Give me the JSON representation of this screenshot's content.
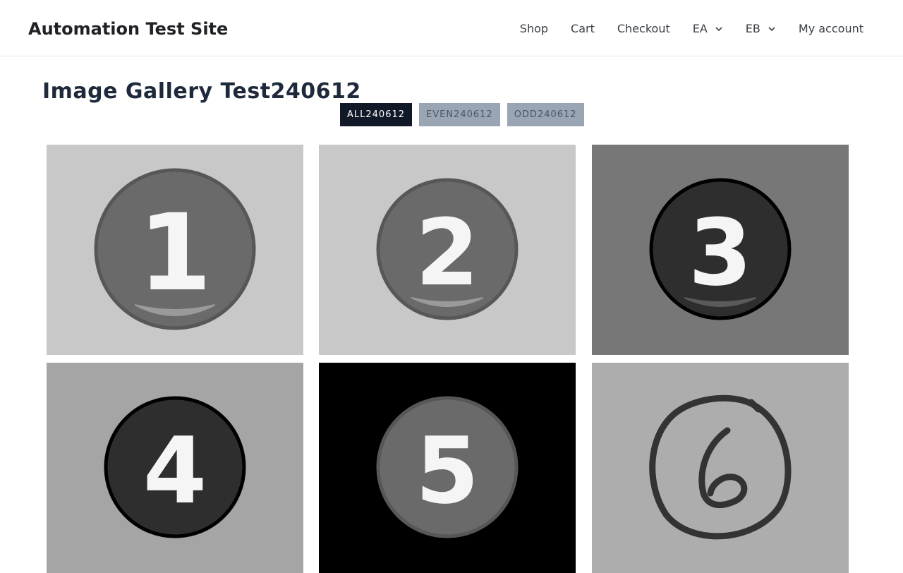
{
  "header": {
    "site_title": "Automation Test Site",
    "nav": [
      {
        "label": "Shop",
        "has_dropdown": false
      },
      {
        "label": "Cart",
        "has_dropdown": false
      },
      {
        "label": "Checkout",
        "has_dropdown": false
      },
      {
        "label": "EA",
        "has_dropdown": true
      },
      {
        "label": "EB",
        "has_dropdown": true
      },
      {
        "label": "My account",
        "has_dropdown": false
      }
    ]
  },
  "main": {
    "title": "Image Gallery Test240612",
    "filters": [
      {
        "label": "ALL240612",
        "active": true
      },
      {
        "label": "EVEN240612",
        "active": false
      },
      {
        "label": "ODD240612",
        "active": false
      }
    ],
    "gallery": [
      {
        "number": "1",
        "style": "gray-badge",
        "bg": "#c8c8c8"
      },
      {
        "number": "2",
        "style": "gray-badge",
        "bg": "#c8c8c8"
      },
      {
        "number": "3",
        "style": "dark-badge",
        "bg": "#777777"
      },
      {
        "number": "4",
        "style": "dark-badge",
        "bg": "#a5a5a5"
      },
      {
        "number": "5",
        "style": "gray-badge",
        "bg": "#000000"
      },
      {
        "number": "6",
        "style": "hand-drawn",
        "bg": "#adadad"
      }
    ]
  },
  "colors": {
    "title": "#1e293b",
    "active_filter_bg": "#111827",
    "inactive_filter_bg": "#9aa5b4"
  }
}
